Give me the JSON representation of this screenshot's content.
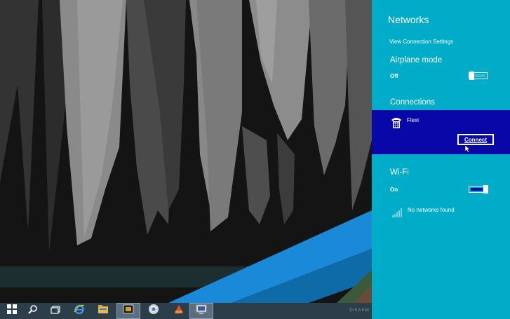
{
  "colors": {
    "panel": "#00acc8",
    "selection": "#0808a8",
    "taskbar": "#2d3e4b"
  },
  "taskbar": {
    "icons": [
      "windows-start-icon",
      "search-icon",
      "task-view-icon",
      "internet-explorer-icon",
      "file-explorer-icon",
      "app-icon",
      "chrome-icon",
      "app-icon",
      "app-icon"
    ],
    "system_info": "Di 5.5 Kbit"
  },
  "networks": {
    "title": "Networks",
    "view_settings_link": "View Connection Settings",
    "airplane": {
      "heading": "Airplane mode",
      "state": "Off",
      "on": false
    },
    "connections": {
      "heading": "Connections",
      "items": [
        {
          "name": "Flexi",
          "icon": "dialup-phone-icon",
          "button": "Connect"
        }
      ]
    },
    "wifi": {
      "heading": "Wi-Fi",
      "state": "On",
      "on": true,
      "empty_message": "No networks found"
    }
  }
}
